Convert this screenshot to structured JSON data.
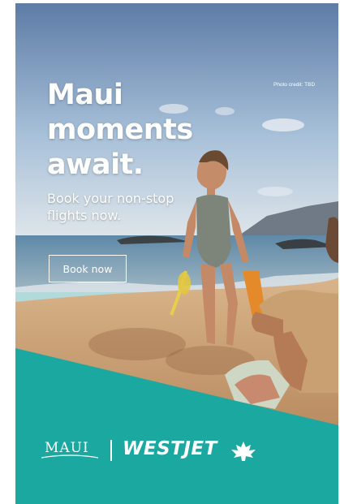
{
  "ad": {
    "headline": [
      "Maui",
      "moments",
      "await."
    ],
    "subhead": [
      "Book your non-stop",
      "flights now."
    ],
    "photo_credit": "Photo credit: TBD",
    "cta_label": "Book now",
    "maui_logo": "MAUI",
    "airline_logo": "WESTJET"
  },
  "colors": {
    "teal": "#1aa8a1",
    "sky_top": "#5f7fa8",
    "sand": "#c79a6b"
  },
  "icons": {
    "airline_mark": "maple-leaf-icon"
  }
}
